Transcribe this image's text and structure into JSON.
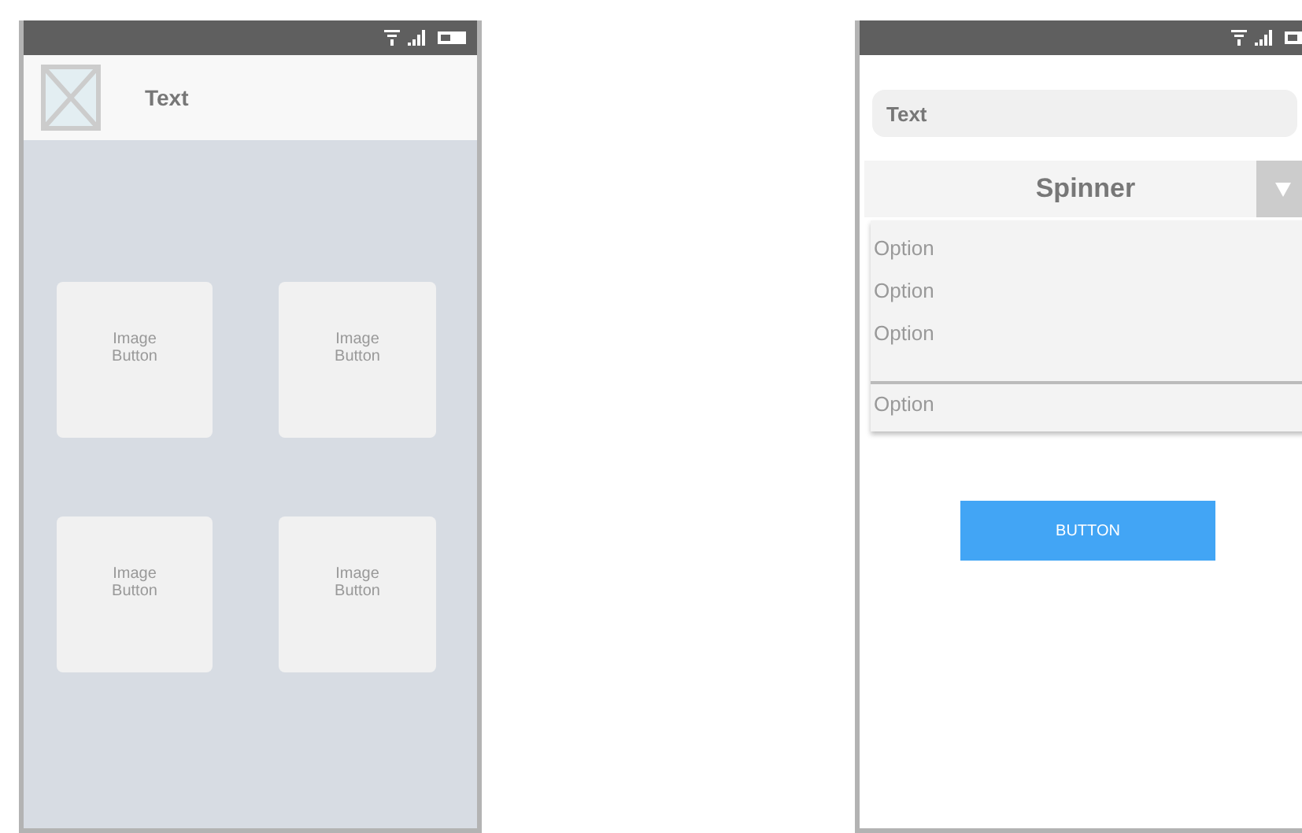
{
  "left_screen": {
    "header": {
      "title": "Text"
    },
    "image_buttons": [
      {
        "label": "Image Button"
      },
      {
        "label": "Image Button"
      },
      {
        "label": "Image Button"
      },
      {
        "label": "Image Button"
      }
    ]
  },
  "right_screen": {
    "text_field": {
      "value": "Text"
    },
    "spinner": {
      "label": "Spinner",
      "expanded": true,
      "options": [
        {
          "label": "Option",
          "divider_before": false
        },
        {
          "label": "Option",
          "divider_before": false
        },
        {
          "label": "Option",
          "divider_before": false
        },
        {
          "label": "Option",
          "divider_before": true
        }
      ]
    },
    "button": {
      "label": "BUTTON"
    }
  }
}
